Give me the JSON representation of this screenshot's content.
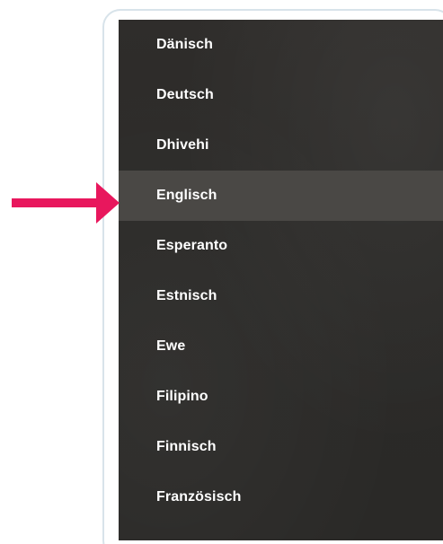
{
  "menu": {
    "items": [
      {
        "label": "Dänisch"
      },
      {
        "label": "Deutsch"
      },
      {
        "label": "Dhivehi"
      },
      {
        "label": "Englisch",
        "selected": true
      },
      {
        "label": "Esperanto"
      },
      {
        "label": "Estnisch"
      },
      {
        "label": "Ewe"
      },
      {
        "label": "Filipino"
      },
      {
        "label": "Finnisch"
      },
      {
        "label": "Französisch"
      }
    ]
  },
  "colors": {
    "menu_background": "#2c2b29",
    "selected_background": "#4a4845",
    "text": "#ffffff",
    "arrow": "#e8175d",
    "frame_border": "#d8e3ea"
  },
  "icons": {
    "pointer": "arrow-right-icon"
  }
}
